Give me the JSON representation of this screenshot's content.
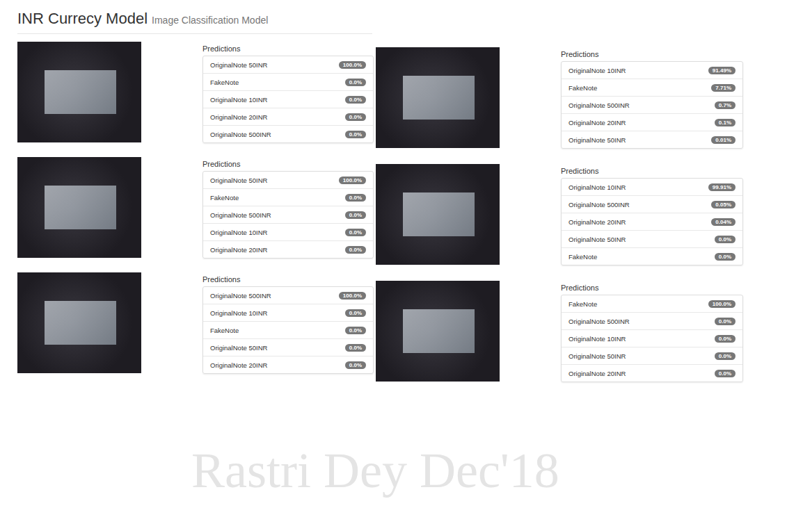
{
  "header": {
    "title": "INR Currecy Model",
    "subtitle": "Image Classification Model"
  },
  "results": [
    {
      "heading": "Predictions",
      "predictions": [
        {
          "label": "OriginalNote 50INR",
          "value": "100.0%"
        },
        {
          "label": "FakeNote",
          "value": "0.0%"
        },
        {
          "label": "OriginalNote 10INR",
          "value": "0.0%"
        },
        {
          "label": "OriginalNote 20INR",
          "value": "0.0%"
        },
        {
          "label": "OriginalNote 500INR",
          "value": "0.0%"
        }
      ]
    },
    {
      "heading": "Predictions",
      "predictions": [
        {
          "label": "OriginalNote 50INR",
          "value": "100.0%"
        },
        {
          "label": "FakeNote",
          "value": "0.0%"
        },
        {
          "label": "OriginalNote 500INR",
          "value": "0.0%"
        },
        {
          "label": "OriginalNote 10INR",
          "value": "0.0%"
        },
        {
          "label": "OriginalNote 20INR",
          "value": "0.0%"
        }
      ]
    },
    {
      "heading": "Predictions",
      "predictions": [
        {
          "label": "OriginalNote 500INR",
          "value": "100.0%"
        },
        {
          "label": "OriginalNote 10INR",
          "value": "0.0%"
        },
        {
          "label": "FakeNote",
          "value": "0.0%"
        },
        {
          "label": "OriginalNote 50INR",
          "value": "0.0%"
        },
        {
          "label": "OriginalNote 20INR",
          "value": "0.0%"
        }
      ]
    },
    {
      "heading": "Predictions",
      "predictions": [
        {
          "label": "OriginalNote 10INR",
          "value": "91.49%"
        },
        {
          "label": "FakeNote",
          "value": "7.71%"
        },
        {
          "label": "OriginalNote 500INR",
          "value": "0.7%"
        },
        {
          "label": "OriginalNote 20INR",
          "value": "0.1%"
        },
        {
          "label": "OriginalNote 50INR",
          "value": "0.01%"
        }
      ]
    },
    {
      "heading": "Predictions",
      "predictions": [
        {
          "label": "OriginalNote 10INR",
          "value": "99.91%"
        },
        {
          "label": "OriginalNote 500INR",
          "value": "0.05%"
        },
        {
          "label": "OriginalNote 20INR",
          "value": "0.04%"
        },
        {
          "label": "OriginalNote 50INR",
          "value": "0.0%"
        },
        {
          "label": "FakeNote",
          "value": "0.0%"
        }
      ]
    },
    {
      "heading": "Predictions",
      "predictions": [
        {
          "label": "FakeNote",
          "value": "100.0%"
        },
        {
          "label": "OriginalNote 500INR",
          "value": "0.0%"
        },
        {
          "label": "OriginalNote 10INR",
          "value": "0.0%"
        },
        {
          "label": "OriginalNote 50INR",
          "value": "0.0%"
        },
        {
          "label": "OriginalNote 20INR",
          "value": "0.0%"
        }
      ]
    }
  ],
  "watermark": "Rastri Dey Dec'18"
}
